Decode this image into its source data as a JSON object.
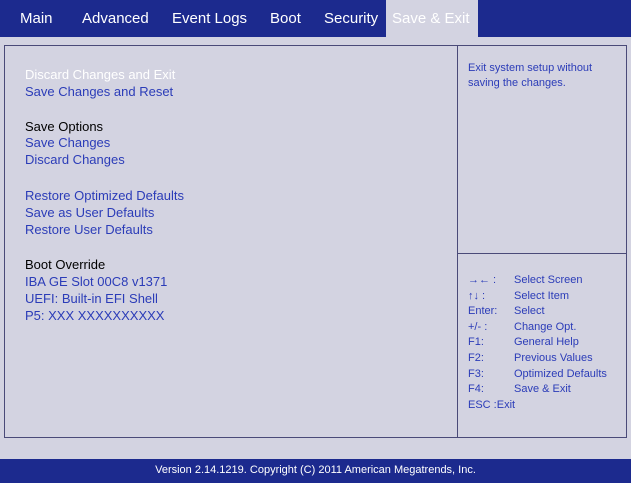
{
  "tabs": [
    {
      "label": "Main"
    },
    {
      "label": "Advanced"
    },
    {
      "label": "Event Logs"
    },
    {
      "label": "Boot"
    },
    {
      "label": "Security"
    },
    {
      "label": "Save & Exit",
      "active": true
    }
  ],
  "menu": {
    "discard_exit": "Discard Changes and Exit",
    "save_reset": "Save Changes and Reset",
    "save_options_heading": "Save Options",
    "save_changes": "Save Changes",
    "discard_changes": "Discard Changes",
    "restore_optimized": "Restore Optimized Defaults",
    "save_user_defaults": "Save as User Defaults",
    "restore_user_defaults": "Restore User Defaults",
    "boot_override_heading": "Boot Override",
    "boot_options": [
      "IBA GE Slot 00C8 v1371",
      "UEFI: Built-in EFI Shell",
      "P5: XXX XXXXXXXXXX"
    ]
  },
  "help": {
    "description": "Exit system setup without saving the changes."
  },
  "keys": [
    {
      "key": "→← :",
      "desc": "Select Screen"
    },
    {
      "key": "↑↓ :",
      "desc": "Select Item"
    },
    {
      "key": "Enter:",
      "desc": "Select"
    },
    {
      "key": "+/- :",
      "desc": "Change Opt."
    },
    {
      "key": "F1:",
      "desc": "General Help"
    },
    {
      "key": "F2:",
      "desc": "Previous Values"
    },
    {
      "key": "F3:",
      "desc": "Optimized Defaults"
    },
    {
      "key": "F4:",
      "desc": "Save & Exit"
    },
    {
      "key": "ESC :Exit",
      "desc": ""
    }
  ],
  "footer": "Version 2.14.1219. Copyright (C) 2011 American Megatrends, Inc.",
  "colors": {
    "bar": "#1c2a8e",
    "panel": "#d3d3e1",
    "link": "#2b3cb8"
  }
}
